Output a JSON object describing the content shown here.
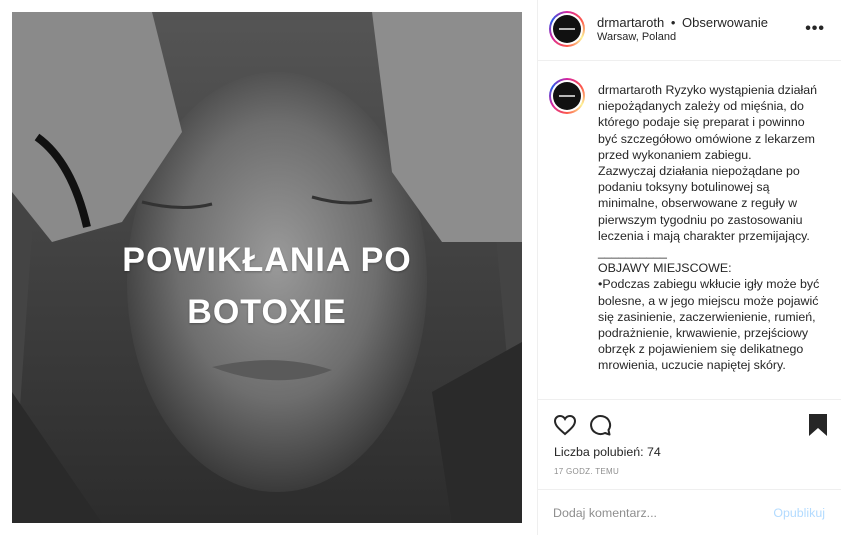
{
  "post_image": {
    "overlay_text_line1": "POWIKŁANIA PO",
    "overlay_text_line2": "BOTOXIE",
    "description": ""
  },
  "header": {
    "username": "drmartaroth",
    "separator": "•",
    "follow_status": "Obserwowanie",
    "location": "Warsaw, Poland",
    "more_icon": "more-horizontal-icon"
  },
  "caption": {
    "username": "drmartaroth",
    "text": " Ryzyko wystąpienia działań niepożądanych zależy od mięśnia, do którego podaje się preparat i powinno być szczegółowo omówione z lekarzem przed wykonaniem zabiegu.\nZazwyczaj działania niepożądane po podaniu toksyny botulinowej są minimalne, obserwowane z reguły w pierwszym tygodniu po zastosowaniu leczenia i mają charakter przemijający.\n__________\nOBJAWY MIEJSCOWE:\n•Podczas zabiegu wkłucie igły może być bolesne, a w jego miejscu może pojawić się zasinienie, zaczerwienienie, rumień, podrażnienie, krwawienie, przejściowy obrzęk z pojawieniem się delikatnego mrowienia, uczucie napiętej skóry."
  },
  "actions": {
    "like_icon": "heart-icon",
    "comment_icon": "comment-icon",
    "save_icon": "bookmark-icon",
    "likes_label": "Liczba polubień: 74",
    "timestamp": "17 GODZ. TEMU"
  },
  "comment_box": {
    "placeholder": "Dodaj komentarz...",
    "post_label": "Opublikuj"
  },
  "colors": {
    "text": "#262626",
    "muted": "#8e8e8e",
    "divider": "#efefef",
    "post_disabled": "#b3dbff"
  }
}
